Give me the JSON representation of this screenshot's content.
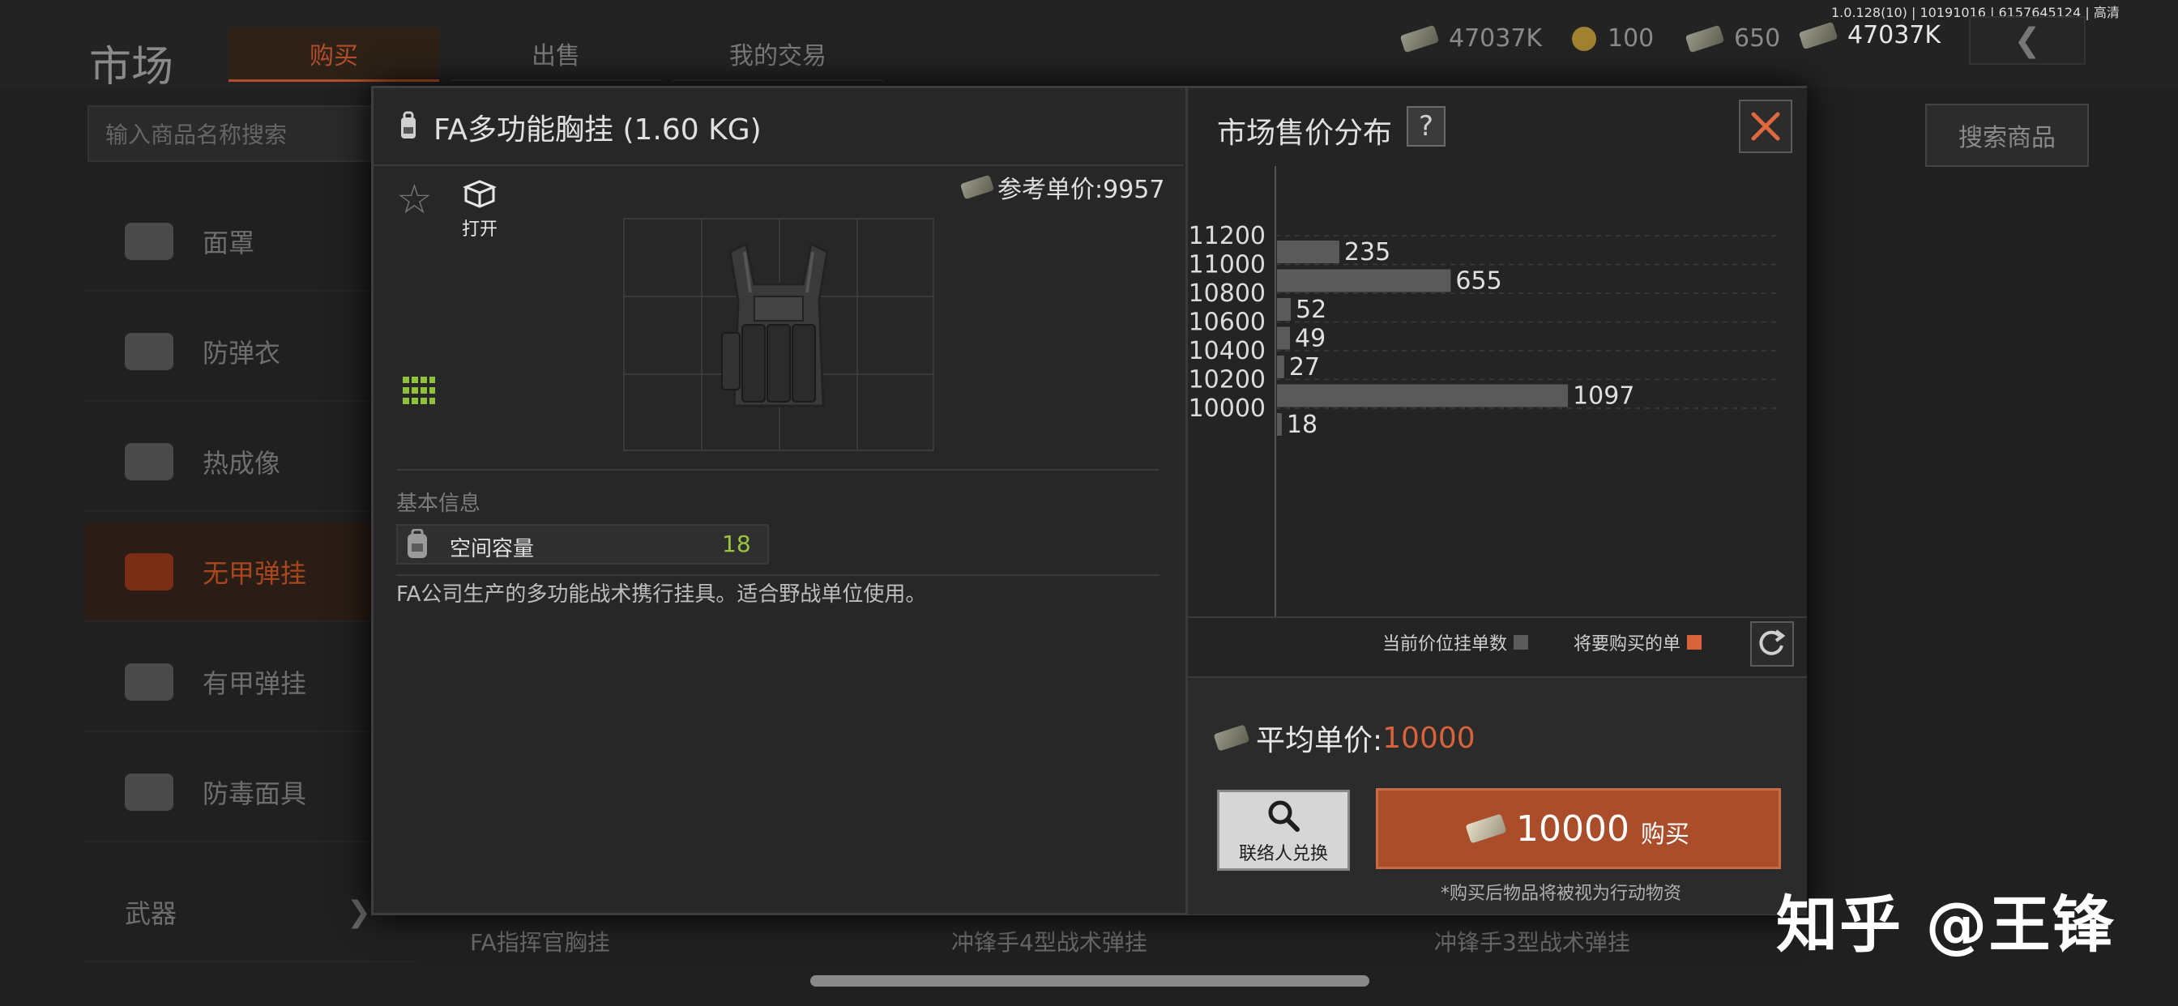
{
  "status_bar": {
    "version": "1.0.128(10) | 10191016 | 6157645124 | 高清"
  },
  "header": {
    "title": "市场",
    "tabs": [
      {
        "label": "购买",
        "active": true
      },
      {
        "label": "出售",
        "active": false
      },
      {
        "label": "我的交易",
        "active": false
      }
    ],
    "currencies": [
      {
        "icon": "cash-icon",
        "value": "47037K"
      },
      {
        "icon": "coin-icon",
        "value": "100"
      },
      {
        "icon": "cash-stack-icon",
        "value": "650"
      },
      {
        "icon": "cash-icon",
        "value": "47037K"
      }
    ],
    "back_icon": "chevron-left-icon"
  },
  "search": {
    "placeholder": "输入商品名称搜索",
    "button_label": "搜索商品"
  },
  "sidebar": {
    "items": [
      {
        "label": "面罩",
        "icon": "mask-icon",
        "active": false
      },
      {
        "label": "防弹衣",
        "icon": "armor-icon",
        "active": false
      },
      {
        "label": "热成像",
        "icon": "thermal-icon",
        "active": false
      },
      {
        "label": "无甲弹挂",
        "icon": "rig-icon",
        "active": true
      },
      {
        "label": "有甲弹挂",
        "icon": "armored-rig-icon",
        "active": false
      },
      {
        "label": "防毒面具",
        "icon": "gasmask-icon",
        "active": false
      },
      {
        "label": "武器",
        "icon": "chevron-right-icon",
        "active": false
      }
    ]
  },
  "background_cards": [
    "FA指挥官胸挂",
    "冲锋手4型战术弹挂",
    "冲锋手3型战术弹挂"
  ],
  "modal": {
    "item_title": "FA多功能胸挂 (1.60 KG)",
    "open_label": "打开",
    "ref_price_label": "参考单价:9957",
    "basic_info_label": "基本信息",
    "stat": {
      "name": "空间容量",
      "value": "18"
    },
    "description": "FA公司生产的多功能战术携行挂具。适合野战单位使用。",
    "distribution_title": "市场售价分布",
    "help_label": "?",
    "legend": {
      "current": "当前价位挂单数",
      "to_buy": "将要购买的单"
    },
    "colors": {
      "bar": "#5a5a5a",
      "to_buy": "#d8633a",
      "accent": "#a94d2a",
      "stat_value": "#9bc440"
    },
    "avg_price_label": "平均单价:",
    "avg_price_value": "10000",
    "contact_label": "联络人兑换",
    "buy_amount": "10000",
    "buy_label": "购买",
    "buy_note": "*购买后物品将被视为行动物资"
  },
  "chart_data": {
    "type": "bar",
    "orientation": "horizontal",
    "y_tick_labels": [
      "11200",
      "11000",
      "10800",
      "10600",
      "10400",
      "10200",
      "10000"
    ],
    "bars": [
      {
        "label": "235",
        "value": 235
      },
      {
        "label": "655",
        "value": 655
      },
      {
        "label": "52",
        "value": 52
      },
      {
        "label": "49",
        "value": 49
      },
      {
        "label": "27",
        "value": 27
      },
      {
        "label": "1097",
        "value": 1097
      },
      {
        "label": "18",
        "value": 18
      }
    ],
    "xlim": [
      0,
      1140
    ],
    "grid": true
  },
  "watermark": "知乎 @王锋"
}
